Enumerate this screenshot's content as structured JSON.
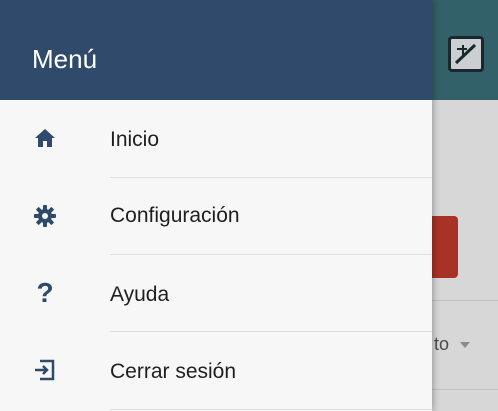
{
  "drawer": {
    "title": "Menú",
    "items": [
      {
        "label": "Inicio",
        "icon": "home-icon"
      },
      {
        "label": "Configuración",
        "icon": "gear-icon"
      },
      {
        "label": "Ayuda",
        "icon": "question-icon"
      },
      {
        "label": "Cerrar sesión",
        "icon": "logout-icon"
      }
    ]
  },
  "background_app": {
    "select_text_fragment": "to"
  },
  "colors": {
    "drawer_header": "#2f4a6b",
    "app_header": "#3b6f78",
    "icon": "#2f4a6b",
    "accent_red": "#c0392b"
  }
}
